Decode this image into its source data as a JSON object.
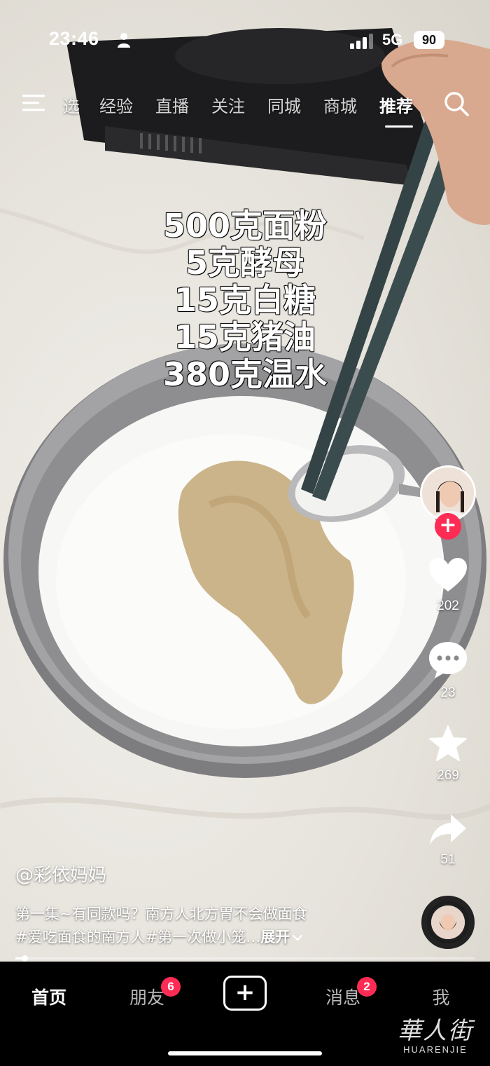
{
  "status_bar": {
    "time": "23:46",
    "network": "5G",
    "battery": "90"
  },
  "top_nav": {
    "tabs": [
      {
        "label": "选",
        "active": false
      },
      {
        "label": "经验",
        "active": false
      },
      {
        "label": "直播",
        "active": false
      },
      {
        "label": "关注",
        "active": false
      },
      {
        "label": "同城",
        "active": false
      },
      {
        "label": "商城",
        "active": false
      },
      {
        "label": "推荐",
        "active": true
      }
    ],
    "menu_icon": "menu-icon",
    "search_icon": "search-icon"
  },
  "video": {
    "recipe_lines": [
      "500克面粉",
      "5克酵母",
      "15克白糖",
      "15克猪油",
      "380克温水"
    ]
  },
  "actions": {
    "likes": "202",
    "comments": "23",
    "favorites": "269",
    "shares": "51",
    "follow_symbol": "+"
  },
  "caption": {
    "author": "@彩依妈妈",
    "line1": "第一集~有同款吗？南方人北方胃不会做面食",
    "line2": "#爱吃面食的南方人#第一次做小笼…",
    "expand": "展开"
  },
  "playback": {
    "progress": 0.02
  },
  "bottom_nav": {
    "home": "首页",
    "friends": "朋友",
    "friends_badge": "6",
    "create_symbol": "+",
    "messages": "消息",
    "messages_badge": "2",
    "me": "我"
  },
  "watermark": {
    "chinese": "華人街",
    "english": "HUARENJIE"
  }
}
